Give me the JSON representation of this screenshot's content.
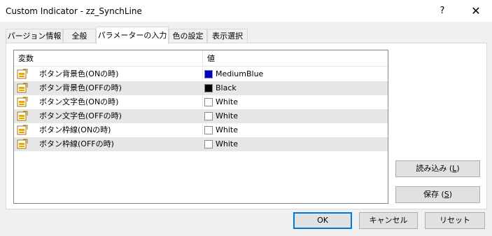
{
  "window": {
    "title": "Custom Indicator - zz_SynchLine",
    "help_glyph": "?",
    "close_glyph": "✕"
  },
  "tabs": [
    {
      "label": "パージョン情報",
      "active": false
    },
    {
      "label": "全般",
      "active": false
    },
    {
      "label": "パラメーターの入力",
      "active": true
    },
    {
      "label": "色の設定",
      "active": false
    },
    {
      "label": "表示選択",
      "active": false
    }
  ],
  "grid": {
    "headers": {
      "variable": "変数",
      "value": "値"
    },
    "rows": [
      {
        "variable": "ボタン背景色(ONの時)",
        "value": "MediumBlue",
        "swatch": "#0000cd"
      },
      {
        "variable": "ボタン背景色(OFFの時)",
        "value": "Black",
        "swatch": "#000000"
      },
      {
        "variable": "ボタン文字色(ONの時)",
        "value": "White",
        "swatch": "#ffffff"
      },
      {
        "variable": "ボタン文字色(OFFの時)",
        "value": "White",
        "swatch": "#ffffff"
      },
      {
        "variable": "ボタン枠線(ONの時)",
        "value": "White",
        "swatch": "#ffffff"
      },
      {
        "variable": "ボタン枠線(OFFの時)",
        "value": "White",
        "swatch": "#ffffff"
      }
    ]
  },
  "side_buttons": {
    "load": {
      "label": "読み込み (",
      "key": "L",
      "suffix": ")"
    },
    "save": {
      "label": "保存 (",
      "key": "S",
      "suffix": ")"
    }
  },
  "footer": {
    "ok": "OK",
    "cancel": "キャンセル",
    "reset": "リセット"
  },
  "colors": {
    "accent": "#0078d7",
    "row_alt": "#e6e6e6",
    "param_icon": "#f0a800"
  }
}
